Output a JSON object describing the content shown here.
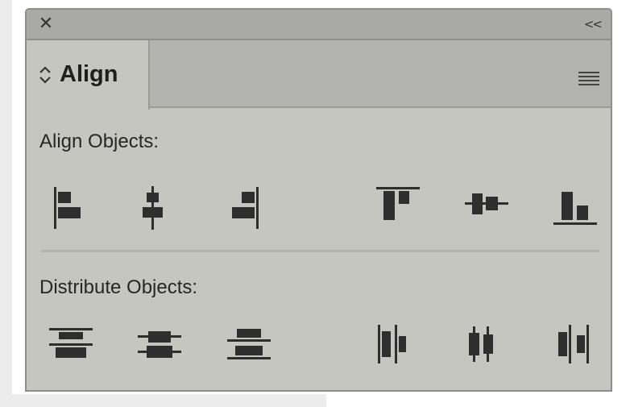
{
  "panel": {
    "close_icon": "close-icon",
    "collapse_label": "<<",
    "tab_label": "Align",
    "tab_icon": "updown-chevron-icon",
    "menu_icon": "panel-menu-icon"
  },
  "sections": {
    "align_objects": "Align Objects:",
    "distribute_objects": "Distribute Objects:"
  },
  "align_buttons": [
    "align-left-edges-icon",
    "align-horizontal-centers-icon",
    "align-right-edges-icon",
    "align-top-edges-icon",
    "align-vertical-centers-icon",
    "align-bottom-edges-icon"
  ],
  "distribute_buttons": [
    "distribute-top-edges-icon",
    "distribute-vertical-centers-icon",
    "distribute-bottom-edges-icon",
    "distribute-left-edges-icon",
    "distribute-horizontal-centers-icon",
    "distribute-right-edges-icon"
  ],
  "colors": {
    "panel_bg": "#c6c6c1",
    "titlebar_bg": "#a9a9a6",
    "icon": "#2e2e2e"
  }
}
